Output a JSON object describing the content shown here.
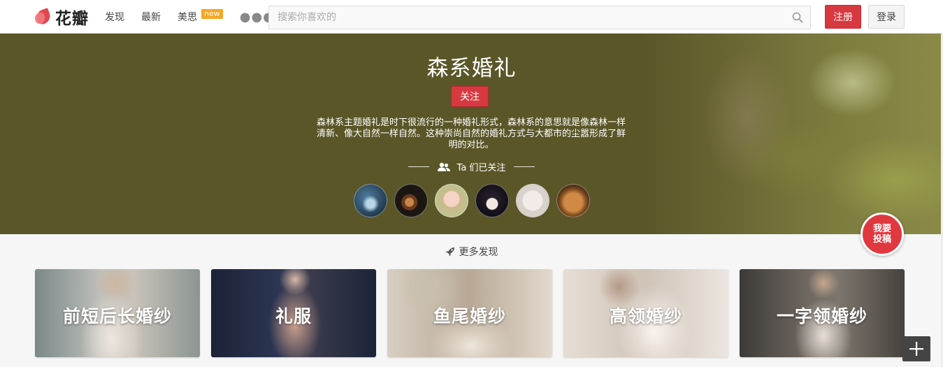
{
  "header": {
    "logo_text": "花瓣",
    "nav": [
      {
        "label": "发现"
      },
      {
        "label": "最新"
      },
      {
        "label": "美思",
        "badge": "new"
      }
    ],
    "more_icon": "more-dots-icon",
    "search": {
      "placeholder": "搜索你喜欢的",
      "value": "",
      "icon": "search-icon"
    },
    "signup_label": "注册",
    "login_label": "登录"
  },
  "hero": {
    "title": "森系婚礼",
    "follow_label": "关注",
    "description": "森林系主题婚礼是时下很流行的一种婚礼形式，森林系的意思就是像森林一样清新、像大自然一样自然。这种崇尚自然的婚礼方式与大都市的尘嚣形成了鲜明的对比。",
    "followers_label": "Ta 们已关注",
    "followers_icon": "users-icon",
    "background_color": "#5a5628"
  },
  "floating": {
    "submit_line1": "我要",
    "submit_line2": "投稿",
    "add_icon": "plus-icon"
  },
  "more": {
    "title": "更多发现",
    "icon": "rocket-icon",
    "cards": [
      {
        "label": "前短后长婚纱"
      },
      {
        "label": "礼服"
      },
      {
        "label": "鱼尾婚纱"
      },
      {
        "label": "高领婚纱"
      },
      {
        "label": "一字领婚纱"
      }
    ]
  },
  "colors": {
    "accent": "#d8383f",
    "badge": "#f5a623"
  }
}
